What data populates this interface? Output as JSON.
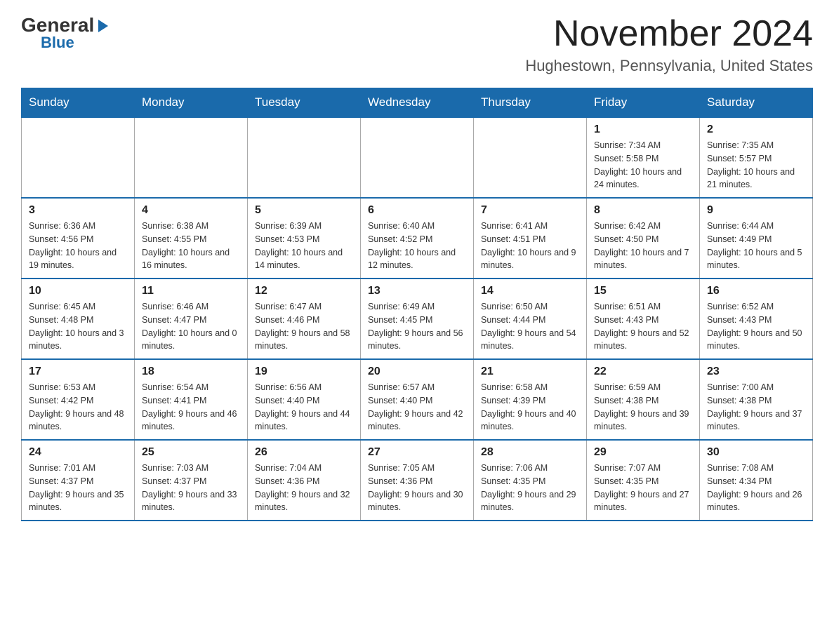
{
  "header": {
    "logo_general": "General",
    "logo_blue": "Blue",
    "month_title": "November 2024",
    "location": "Hughestown, Pennsylvania, United States"
  },
  "weekdays": [
    "Sunday",
    "Monday",
    "Tuesday",
    "Wednesday",
    "Thursday",
    "Friday",
    "Saturday"
  ],
  "weeks": [
    [
      {
        "day": "",
        "info": ""
      },
      {
        "day": "",
        "info": ""
      },
      {
        "day": "",
        "info": ""
      },
      {
        "day": "",
        "info": ""
      },
      {
        "day": "",
        "info": ""
      },
      {
        "day": "1",
        "info": "Sunrise: 7:34 AM\nSunset: 5:58 PM\nDaylight: 10 hours and 24 minutes."
      },
      {
        "day": "2",
        "info": "Sunrise: 7:35 AM\nSunset: 5:57 PM\nDaylight: 10 hours and 21 minutes."
      }
    ],
    [
      {
        "day": "3",
        "info": "Sunrise: 6:36 AM\nSunset: 4:56 PM\nDaylight: 10 hours and 19 minutes."
      },
      {
        "day": "4",
        "info": "Sunrise: 6:38 AM\nSunset: 4:55 PM\nDaylight: 10 hours and 16 minutes."
      },
      {
        "day": "5",
        "info": "Sunrise: 6:39 AM\nSunset: 4:53 PM\nDaylight: 10 hours and 14 minutes."
      },
      {
        "day": "6",
        "info": "Sunrise: 6:40 AM\nSunset: 4:52 PM\nDaylight: 10 hours and 12 minutes."
      },
      {
        "day": "7",
        "info": "Sunrise: 6:41 AM\nSunset: 4:51 PM\nDaylight: 10 hours and 9 minutes."
      },
      {
        "day": "8",
        "info": "Sunrise: 6:42 AM\nSunset: 4:50 PM\nDaylight: 10 hours and 7 minutes."
      },
      {
        "day": "9",
        "info": "Sunrise: 6:44 AM\nSunset: 4:49 PM\nDaylight: 10 hours and 5 minutes."
      }
    ],
    [
      {
        "day": "10",
        "info": "Sunrise: 6:45 AM\nSunset: 4:48 PM\nDaylight: 10 hours and 3 minutes."
      },
      {
        "day": "11",
        "info": "Sunrise: 6:46 AM\nSunset: 4:47 PM\nDaylight: 10 hours and 0 minutes."
      },
      {
        "day": "12",
        "info": "Sunrise: 6:47 AM\nSunset: 4:46 PM\nDaylight: 9 hours and 58 minutes."
      },
      {
        "day": "13",
        "info": "Sunrise: 6:49 AM\nSunset: 4:45 PM\nDaylight: 9 hours and 56 minutes."
      },
      {
        "day": "14",
        "info": "Sunrise: 6:50 AM\nSunset: 4:44 PM\nDaylight: 9 hours and 54 minutes."
      },
      {
        "day": "15",
        "info": "Sunrise: 6:51 AM\nSunset: 4:43 PM\nDaylight: 9 hours and 52 minutes."
      },
      {
        "day": "16",
        "info": "Sunrise: 6:52 AM\nSunset: 4:43 PM\nDaylight: 9 hours and 50 minutes."
      }
    ],
    [
      {
        "day": "17",
        "info": "Sunrise: 6:53 AM\nSunset: 4:42 PM\nDaylight: 9 hours and 48 minutes."
      },
      {
        "day": "18",
        "info": "Sunrise: 6:54 AM\nSunset: 4:41 PM\nDaylight: 9 hours and 46 minutes."
      },
      {
        "day": "19",
        "info": "Sunrise: 6:56 AM\nSunset: 4:40 PM\nDaylight: 9 hours and 44 minutes."
      },
      {
        "day": "20",
        "info": "Sunrise: 6:57 AM\nSunset: 4:40 PM\nDaylight: 9 hours and 42 minutes."
      },
      {
        "day": "21",
        "info": "Sunrise: 6:58 AM\nSunset: 4:39 PM\nDaylight: 9 hours and 40 minutes."
      },
      {
        "day": "22",
        "info": "Sunrise: 6:59 AM\nSunset: 4:38 PM\nDaylight: 9 hours and 39 minutes."
      },
      {
        "day": "23",
        "info": "Sunrise: 7:00 AM\nSunset: 4:38 PM\nDaylight: 9 hours and 37 minutes."
      }
    ],
    [
      {
        "day": "24",
        "info": "Sunrise: 7:01 AM\nSunset: 4:37 PM\nDaylight: 9 hours and 35 minutes."
      },
      {
        "day": "25",
        "info": "Sunrise: 7:03 AM\nSunset: 4:37 PM\nDaylight: 9 hours and 33 minutes."
      },
      {
        "day": "26",
        "info": "Sunrise: 7:04 AM\nSunset: 4:36 PM\nDaylight: 9 hours and 32 minutes."
      },
      {
        "day": "27",
        "info": "Sunrise: 7:05 AM\nSunset: 4:36 PM\nDaylight: 9 hours and 30 minutes."
      },
      {
        "day": "28",
        "info": "Sunrise: 7:06 AM\nSunset: 4:35 PM\nDaylight: 9 hours and 29 minutes."
      },
      {
        "day": "29",
        "info": "Sunrise: 7:07 AM\nSunset: 4:35 PM\nDaylight: 9 hours and 27 minutes."
      },
      {
        "day": "30",
        "info": "Sunrise: 7:08 AM\nSunset: 4:34 PM\nDaylight: 9 hours and 26 minutes."
      }
    ]
  ]
}
